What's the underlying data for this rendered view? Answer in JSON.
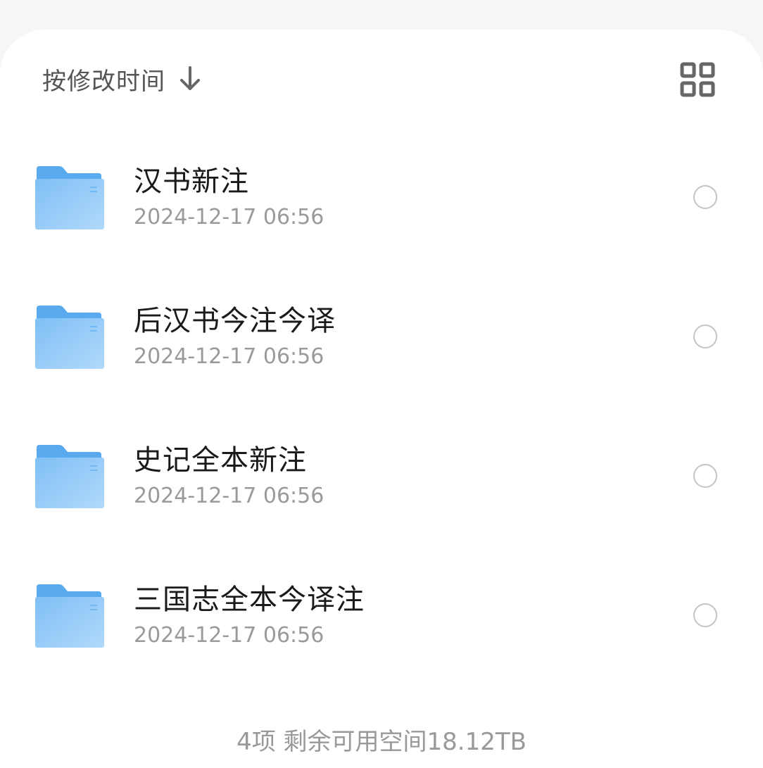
{
  "sort": {
    "label": "按修改时间",
    "direction_icon": "arrow-down-icon"
  },
  "view_toggle": {
    "icon": "grid-view-icon"
  },
  "items": [
    {
      "name": "汉书新注",
      "date": "2024-12-17 06:56",
      "icon": "folder-icon",
      "selected": false
    },
    {
      "name": "后汉书今注今译",
      "date": "2024-12-17 06:56",
      "icon": "folder-icon",
      "selected": false
    },
    {
      "name": "史记全本新注",
      "date": "2024-12-17 06:56",
      "icon": "folder-icon",
      "selected": false
    },
    {
      "name": "三国志全本今译注",
      "date": "2024-12-17 06:56",
      "icon": "folder-icon",
      "selected": false
    }
  ],
  "footer": {
    "summary": "4项 剩余可用空间18.12TB"
  },
  "colors": {
    "folder_back": "#5aaaf0",
    "folder_front_top": "#7fbff5",
    "folder_front_bottom": "#a9d4fa",
    "background": "#f5f6f8",
    "sheet": "#ffffff"
  }
}
